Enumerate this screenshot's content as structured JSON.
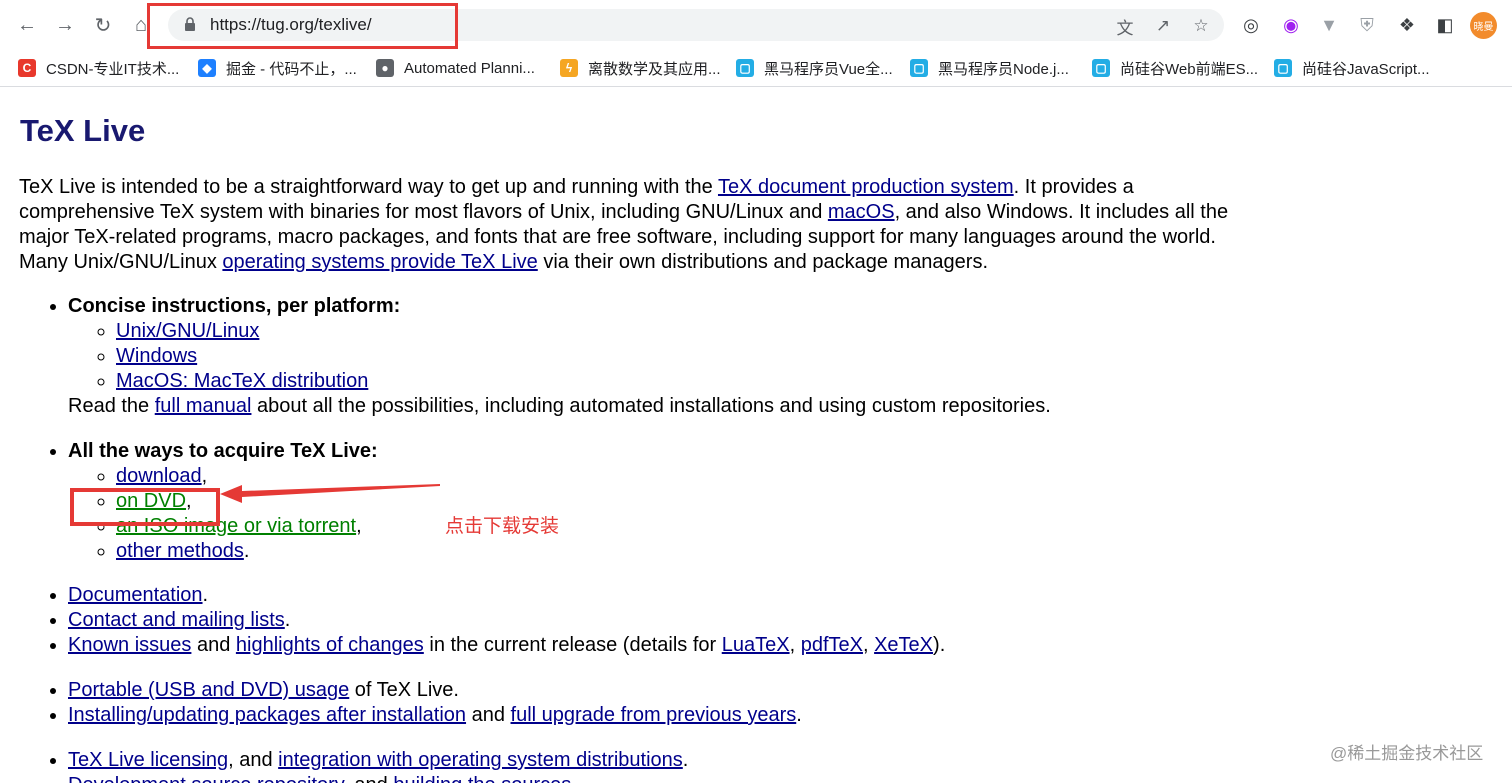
{
  "browser": {
    "url": "https://tug.org/texlive/",
    "profile_initials": "晓曼"
  },
  "bookmarks": [
    {
      "label": "CSDN-专业IT技术...",
      "icon": "csdn-icon",
      "color": "#e8382c",
      "glyph": "C"
    },
    {
      "label": "掘金 - 代码不止，...",
      "icon": "juejin-icon",
      "color": "#1e80ff",
      "glyph": "◆"
    },
    {
      "label": "Automated Planni...",
      "icon": "globe-icon",
      "color": "#5f6368",
      "glyph": "●"
    },
    {
      "label": "离散数学及其应用...",
      "icon": "bolt-icon",
      "color": "#f5a623",
      "glyph": "ϟ"
    },
    {
      "label": "黑马程序员Vue全...",
      "icon": "bilibili-icon",
      "color": "#23ade5",
      "glyph": "▢"
    },
    {
      "label": "黑马程序员Node.j...",
      "icon": "bilibili-icon",
      "color": "#23ade5",
      "glyph": "▢"
    },
    {
      "label": "尚硅谷Web前端ES...",
      "icon": "bilibili-icon",
      "color": "#23ade5",
      "glyph": "▢"
    },
    {
      "label": "尚硅谷JavaScript...",
      "icon": "bilibili-icon",
      "color": "#23ade5",
      "glyph": "▢"
    }
  ],
  "page": {
    "title": "TeX Live",
    "intro": {
      "t1": "TeX Live is intended to be a straightforward way to get up and running with the ",
      "l1": "TeX document production system",
      "t2": ". It provides a comprehensive TeX system with binaries for most flavors of Unix, including GNU/Linux and ",
      "l2": "macOS",
      "t3": ", and also Windows. It includes all the major TeX-related programs, macro packages, and fonts that are free software, including support for many languages around the world. Many Unix/GNU/Linux ",
      "l3": "operating systems provide TeX Live",
      "t4": " via their own distributions and package managers."
    },
    "concise": {
      "heading": "Concise instructions, per platform:",
      "items": [
        "Unix/GNU/Linux",
        "Windows",
        "MacOS: MacTeX distribution"
      ],
      "read_pre": "Read the ",
      "read_link": "full manual",
      "read_post": " about all the possibilities, including automated installations and using custom repositories."
    },
    "acquire": {
      "heading": "All the ways to acquire TeX Live:",
      "download": "download",
      "dvd": "on DVD",
      "iso": "an ISO image or via torrent",
      "other": "other methods",
      "comma": ",",
      "period": "."
    },
    "docs": {
      "documentation": "Documentation",
      "contact": "Contact and mailing lists",
      "known": "Known issues",
      "and": " and ",
      "highlights": "highlights of changes",
      "release_text": " in the current release (details for ",
      "luatex": "LuaTeX",
      "pdftex": "pdfTeX",
      "xetex": "XeTeX",
      "close": ").",
      "sep": ", "
    },
    "usage": {
      "portable": "Portable (USB and DVD) usage",
      "portable_post": " of TeX Live.",
      "installing": "Installing/updating packages after installation",
      "and": " and ",
      "upgrade": "full upgrade from previous years",
      "period": "."
    },
    "licensing": {
      "licensing": "TeX Live licensing",
      "mid": ", and ",
      "integration": "integration with operating system distributions",
      "period": ".",
      "devsrc": "Development source repository",
      "devmid": ", and ",
      "building": "building the sources",
      "devperiod": "."
    }
  },
  "annotation": {
    "text": "点击下载安装",
    "color": "#e53935"
  },
  "watermark": "@稀土掘金技术社区"
}
